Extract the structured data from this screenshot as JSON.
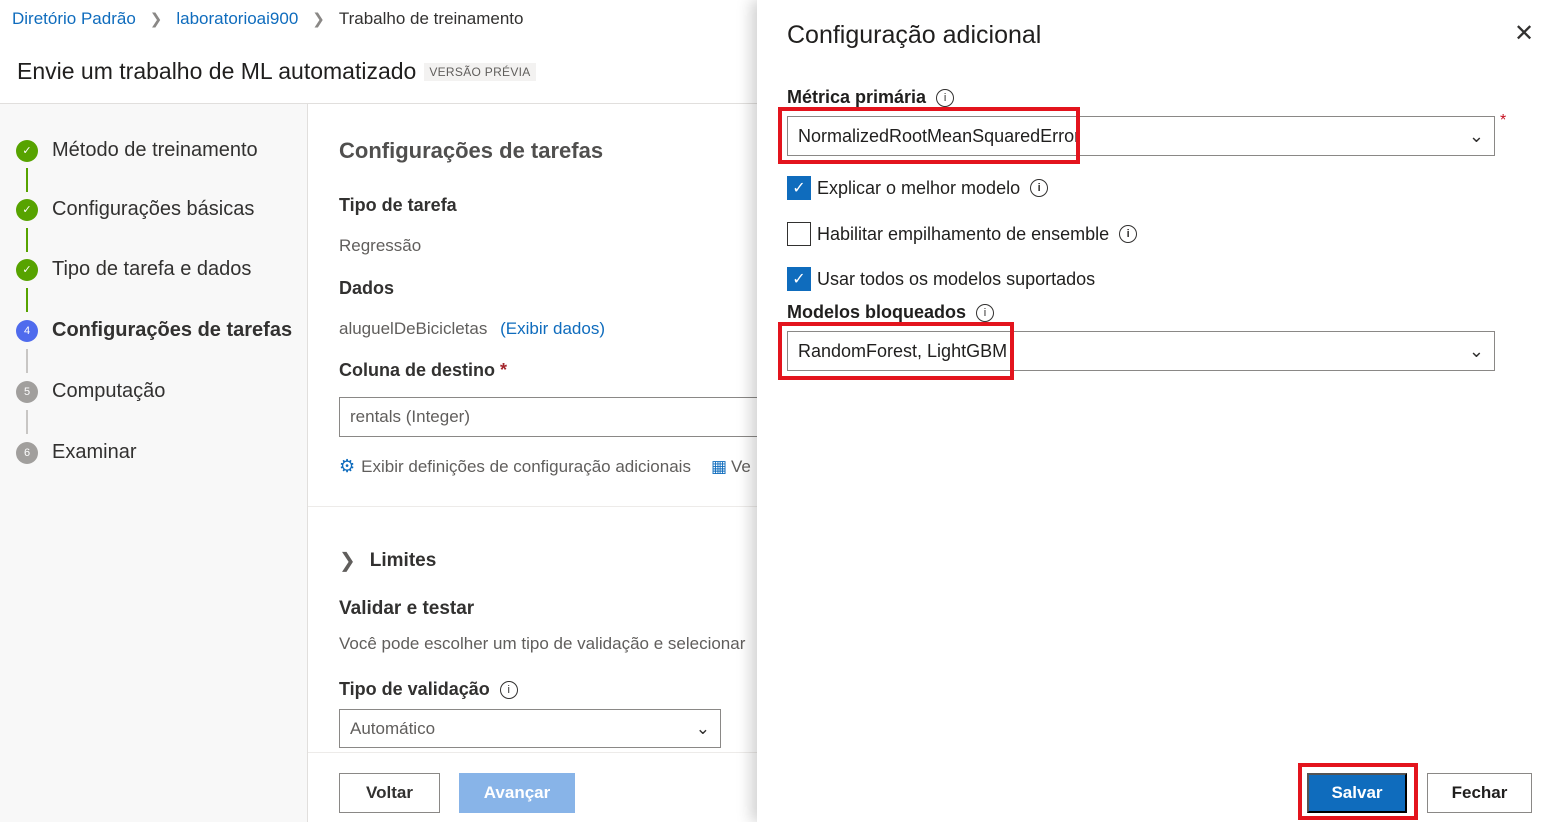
{
  "breadcrumb": {
    "items": [
      "Diretório Padrão",
      "laboratorioai900",
      "Trabalho de treinamento"
    ]
  },
  "page": {
    "title": "Envie um trabalho de ML automatizado",
    "badge": "VERSÃO PRÉVIA"
  },
  "steps": [
    {
      "label": "Método de treinamento",
      "state": "done"
    },
    {
      "label": "Configurações básicas",
      "state": "done"
    },
    {
      "label": "Tipo de tarefa e dados",
      "state": "done"
    },
    {
      "label": "Configurações de tarefas",
      "state": "current",
      "number": "4"
    },
    {
      "label": "Computação",
      "state": "todo",
      "number": "5"
    },
    {
      "label": "Examinar",
      "state": "todo",
      "number": "6"
    }
  ],
  "main": {
    "section_title": "Configurações de tarefas",
    "task_type_label": "Tipo de tarefa",
    "task_type_value": "Regressão",
    "data_label": "Dados",
    "data_value": "aluguelDeBicicletas",
    "data_link": "(Exibir dados)",
    "target_label": "Coluna de destino",
    "target_required": "*",
    "target_value": "rentals (Integer)",
    "more_settings_link": "Exibir definições de configuração adicionais",
    "more_settings_link2": "Ve",
    "limits_label": "Limites",
    "validate_title": "Validar e testar",
    "validate_desc": "Você pode escolher um tipo de validação e selecionar",
    "validation_type_label": "Tipo de validação",
    "validation_type_value": "Automático",
    "back_button": "Voltar",
    "next_button": "Avançar"
  },
  "panel": {
    "title": "Configuração adicional",
    "primary_metric_label": "Métrica primária",
    "primary_metric_value": "NormalizedRootMeanSquaredError",
    "required_mark": "*",
    "explain_best_model": {
      "label": "Explicar o melhor modelo",
      "checked": true
    },
    "ensemble_stacking": {
      "label": "Habilitar empilhamento de ensemble",
      "checked": false
    },
    "use_all_models": {
      "label": "Usar todos os modelos suportados",
      "checked": true
    },
    "blocked_models_label": "Modelos bloqueados",
    "blocked_models_value": "RandomForest, LightGBM",
    "save_button": "Salvar",
    "close_button": "Fechar"
  },
  "colors": {
    "accent": "#0f6cbd",
    "step_done": "#57a300",
    "step_current": "#4f6bed",
    "highlight": "#e3141d"
  }
}
